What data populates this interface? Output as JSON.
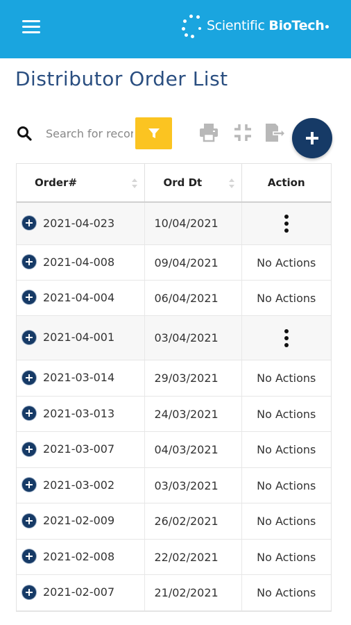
{
  "header": {
    "brand_light": "Scientific ",
    "brand_bold": "BioTech",
    "brand_color": "#1aa5df"
  },
  "page": {
    "title": "Distributor Order List"
  },
  "toolbar": {
    "search_placeholder": "Search for records",
    "icons": [
      "search-icon",
      "filter-icon",
      "print-icon",
      "collapse-icon",
      "export-icon",
      "add-icon"
    ],
    "filter_color": "#fbc421",
    "add_color": "#163a66"
  },
  "table": {
    "headers": {
      "order": "Order#",
      "date": "Ord Dt",
      "action": "Action"
    },
    "rows": [
      {
        "order": "2021-04-023",
        "date": "10/04/2021",
        "action": ""
      },
      {
        "order": "2021-04-008",
        "date": "09/04/2021",
        "action": "No Actions"
      },
      {
        "order": "2021-04-004",
        "date": "06/04/2021",
        "action": "No Actions"
      },
      {
        "order": "2021-04-001",
        "date": "03/04/2021",
        "action": ""
      },
      {
        "order": "2021-03-014",
        "date": "29/03/2021",
        "action": "No Actions"
      },
      {
        "order": "2021-03-013",
        "date": "24/03/2021",
        "action": "No Actions"
      },
      {
        "order": "2021-03-007",
        "date": "04/03/2021",
        "action": "No Actions"
      },
      {
        "order": "2021-03-002",
        "date": "03/03/2021",
        "action": "No Actions"
      },
      {
        "order": "2021-02-009",
        "date": "26/02/2021",
        "action": "No Actions"
      },
      {
        "order": "2021-02-008",
        "date": "22/02/2021",
        "action": "No Actions"
      },
      {
        "order": "2021-02-007",
        "date": "21/02/2021",
        "action": "No Actions"
      }
    ]
  }
}
